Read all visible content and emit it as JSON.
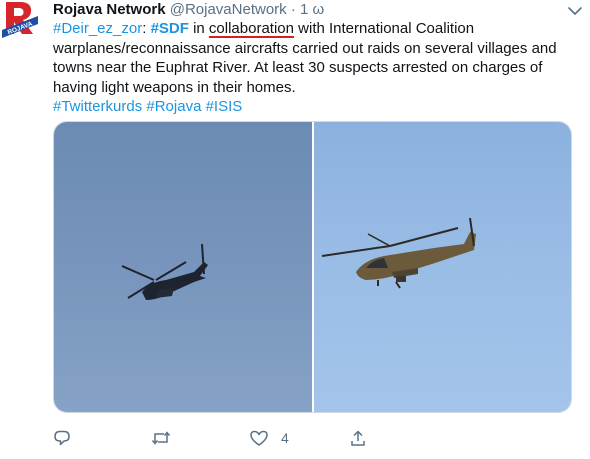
{
  "tweet": {
    "avatar_text": "ROJAVA",
    "display_name": "Rojava Network",
    "handle": "@RojavaNetwork",
    "separator": "·",
    "time": "1 ω",
    "text": {
      "tag_deir": "#Deir_ez_zor",
      "colon": ": ",
      "tag_sdf": "#SDF",
      "in": " in ",
      "collaboration": "collaboration",
      "rest": " with International Coalition warplanes/reconnaissance aircrafts carried out raids on several villages and towns near the Euphrat River. At least 30 suspects arrested on charges of having light weapons in their homes.",
      "tag_twitterkurds": "#Twitterkurds",
      "tag_rojava": "#Rojava",
      "tag_isis": "#ISIS"
    },
    "actions": {
      "reply_count": "",
      "retweet_count": "",
      "like_count": "4",
      "share_count": ""
    },
    "icons": [
      "caret-down-icon",
      "reply-icon",
      "retweet-icon",
      "like-icon",
      "share-icon"
    ]
  },
  "colors": {
    "link": "#1b95e0",
    "underline_annotation": "#d61f1f",
    "muted": "#5b7083",
    "avatar_red": "#d6262b",
    "avatar_blue": "#1e4fa3"
  }
}
